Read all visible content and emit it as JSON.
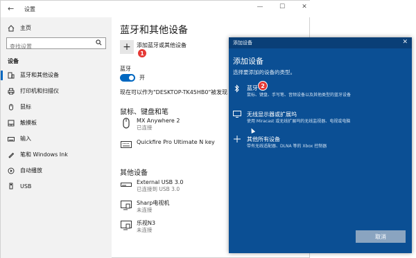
{
  "settings": {
    "title": "设置",
    "back": "←",
    "controls": [
      "—",
      "☐",
      "✕"
    ],
    "search_placeholder": "查找设置",
    "nav": {
      "home": "主页",
      "section": "设备",
      "items": [
        "蓝牙和其他设备",
        "打印机和扫描仪",
        "鼠标",
        "触摸板",
        "输入",
        "笔和 Windows Ink",
        "自动播放",
        "USB"
      ]
    },
    "main": {
      "title": "蓝牙和其他设备",
      "add_label": "添加蓝牙或其他设备",
      "bluetooth_label": "蓝牙",
      "toggle_state": "开",
      "toggle_on": true,
      "discoverable": "现在可以作为\"DESKTOP-TK45HB0\"被发现",
      "mouse_section": "鼠标、键盘和笔",
      "mouse_devices": [
        {
          "name": "MX Anywhere 2",
          "status": "已连接",
          "icon": "mouse-icon"
        },
        {
          "name": "Quickfire Pro Ultimate N key",
          "status": "",
          "icon": "keyboard-icon"
        }
      ],
      "other_section": "其他设备",
      "other_devices": [
        {
          "name": "External USB 3.0",
          "status": "已连接到 USB 3.0",
          "icon": "drive-icon"
        },
        {
          "name": "Sharp电视机",
          "status": "未连接",
          "icon": "tv-icon"
        },
        {
          "name": "乐视N3",
          "status": "未连接",
          "icon": "tv-icon"
        }
      ]
    }
  },
  "dialog": {
    "window_title": "添加设备",
    "close": "✕",
    "title": "添加设备",
    "subtitle": "选择要添加的设备的类型。",
    "options": [
      {
        "title": "蓝牙",
        "desc": "鼠标、键盘、手写笔、音频设备以及其他类型的蓝牙设备",
        "icon": "bluetooth-icon"
      },
      {
        "title": "无线显示器或扩展坞",
        "desc": "使用 Miracast 或无线扩展坞的无线监视器、电视或电脑",
        "icon": "display-icon"
      },
      {
        "title": "其他所有设备",
        "desc": "带有无线适配器、DLNA 等的 Xbox 控制器",
        "icon": "plus-icon"
      }
    ],
    "cancel": "取消"
  },
  "badges": [
    "1",
    "2"
  ],
  "colors": {
    "accent": "#0067c0",
    "dialog_bg": "#0b4f94",
    "badge": "#e53935"
  }
}
